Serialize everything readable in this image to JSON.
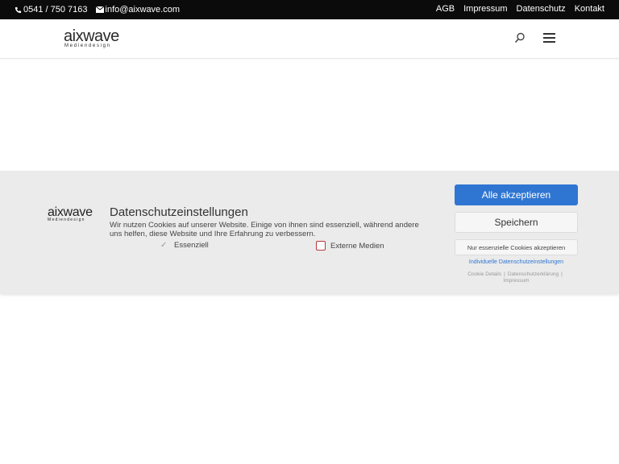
{
  "topbar": {
    "phone": "0541 / 750 7163",
    "email": "info@aixwave.com",
    "links": [
      "AGB",
      "Impressum",
      "Datenschutz",
      "Kontakt"
    ]
  },
  "header": {
    "logo_word": "aixwave",
    "logo_sub": "Mediendesign"
  },
  "cookie_banner": {
    "logo_word": "aixwave",
    "logo_sub": "Mediendesign",
    "title": "Datenschutzeinstellungen",
    "text": "Wir nutzen Cookies auf unserer Website. Einige von ihnen sind essenziell, während andere uns helfen, diese Website und Ihre Erfahrung zu verbessern.",
    "option_essential": "Essenziell",
    "option_external": "Externe Medien",
    "accept_all": "Alle akzeptieren",
    "save": "Speichern",
    "essential_only": "Nur essenzielle Cookies akzeptieren",
    "individual": "Individuelle Datenschutzeinstellungen",
    "cookie_details": "Cookie Details",
    "privacy": "Datenschutzerklärung",
    "imprint": "Impressum",
    "sep": "|"
  },
  "colors": {
    "accent": "#2f76d2",
    "topbar_bg": "#0b0b0b",
    "overlay_bg": "#ebebeb",
    "checkbox_border": "#b63a3a"
  }
}
